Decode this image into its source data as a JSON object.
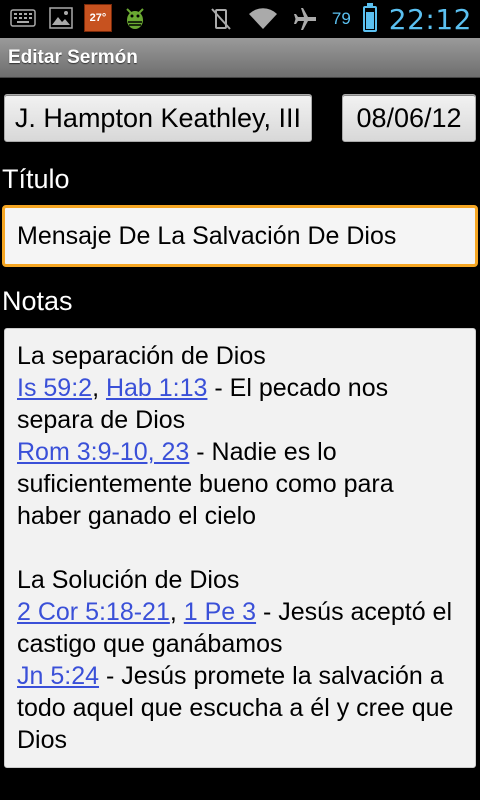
{
  "statusbar": {
    "temperature": "27°",
    "battery_pct": "79",
    "battery_level": 0.79,
    "time": "22:12"
  },
  "titlebar": {
    "title": "Editar Sermón"
  },
  "buttons": {
    "author": "J. Hampton Keathley, III",
    "date": "08/06/12"
  },
  "labels": {
    "title": "Título",
    "notes": "Notas"
  },
  "title_field": {
    "value": "Mensaje De La Salvación De Dios"
  },
  "notes": {
    "section1": {
      "heading": "La separación de Dios",
      "line1_link1": "Is 59:2",
      "line1_sep": ", ",
      "line1_link2": "Hab 1:13",
      "line1_text": " - El pecado nos separa de Dios",
      "line2_link": "Rom 3:9-10, 23",
      "line2_text": " - Nadie es lo suficientemente bueno como para haber ganado el cielo"
    },
    "section2": {
      "heading": "La Solución de Dios",
      "line1_link1": "2 Cor 5:18-21",
      "line1_sep": ", ",
      "line1_link2": "1 Pe 3",
      "line1_text": " - Jesús aceptó el castigo que ganábamos",
      "line2_link": "Jn 5:24",
      "line2_text": " - Jesús promete la salvación a todo aquel que escucha a él y cree que Dios"
    }
  }
}
